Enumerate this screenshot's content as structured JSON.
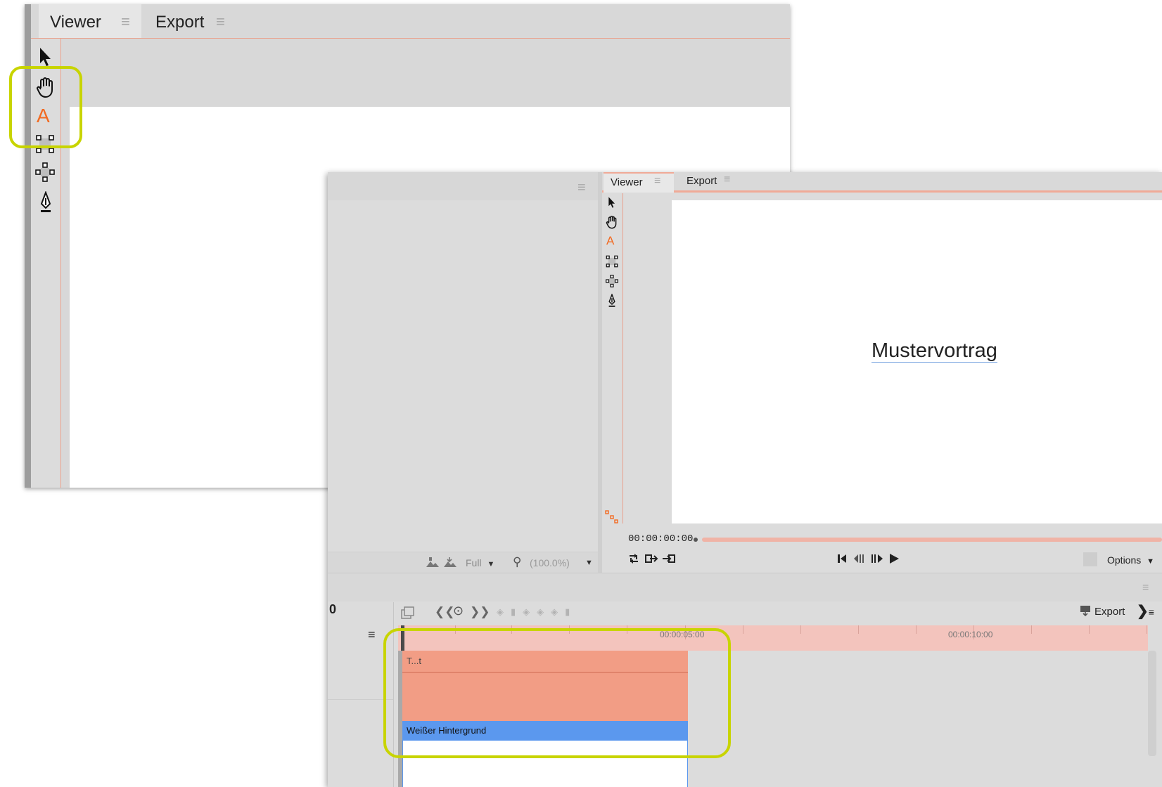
{
  "zoomed_window": {
    "tabs": [
      {
        "label": "Viewer"
      },
      {
        "label": "Export"
      }
    ]
  },
  "main_window": {
    "viewer_tabs": [
      {
        "label": "Viewer"
      },
      {
        "label": "Export"
      }
    ],
    "preview_title": "Mustervortrag",
    "timecode": "00:00:00:00",
    "quality": "Full",
    "zoom": "(100.0%)",
    "options_label": "Options",
    "timeline": {
      "frame_digit": "0",
      "export_label": "Export",
      "ruler_labels": [
        "00:00:05:00",
        "00:00:10:00"
      ],
      "clips": [
        {
          "label": "T...t",
          "color": "#f29d85"
        },
        {
          "label": "Weißer Hintergrund",
          "color": "#5b98ee"
        }
      ]
    }
  },
  "colors": {
    "accent_orange": "#f26a21",
    "highlight_green": "#c8d400",
    "clip_salmon": "#f29d85",
    "clip_blue": "#5b98ee",
    "ruler_pink": "#f3c4bd"
  }
}
